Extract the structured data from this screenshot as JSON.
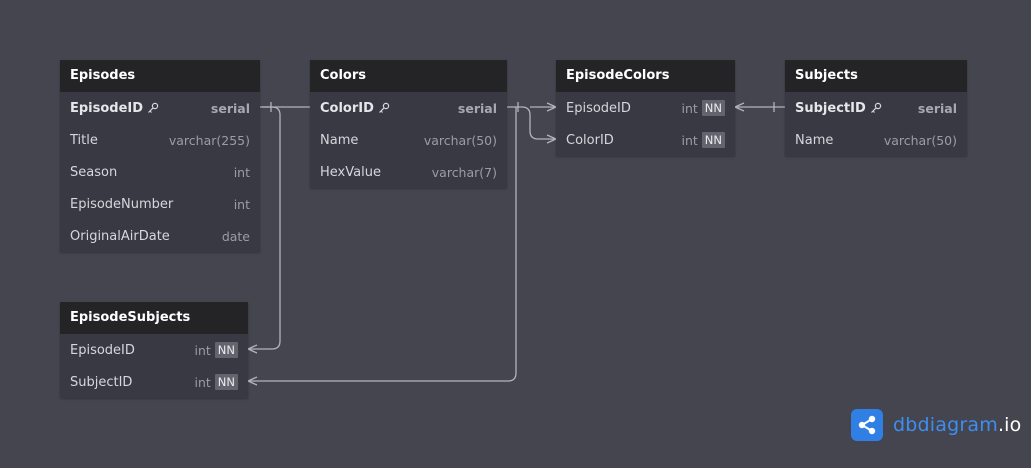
{
  "tables": {
    "episodes": {
      "name": "Episodes",
      "rows": [
        {
          "name": "EpisodeID",
          "type": "serial",
          "pk": true
        },
        {
          "name": "Title",
          "type": "varchar(255)"
        },
        {
          "name": "Season",
          "type": "int"
        },
        {
          "name": "EpisodeNumber",
          "type": "int"
        },
        {
          "name": "OriginalAirDate",
          "type": "date"
        }
      ]
    },
    "colors": {
      "name": "Colors",
      "rows": [
        {
          "name": "ColorID",
          "type": "serial",
          "pk": true
        },
        {
          "name": "Name",
          "type": "varchar(50)"
        },
        {
          "name": "HexValue",
          "type": "varchar(7)"
        }
      ]
    },
    "episode_colors": {
      "name": "EpisodeColors",
      "rows": [
        {
          "name": "EpisodeID",
          "type": "int",
          "nn": "NN"
        },
        {
          "name": "ColorID",
          "type": "int",
          "nn": "NN"
        }
      ]
    },
    "subjects": {
      "name": "Subjects",
      "rows": [
        {
          "name": "SubjectID",
          "type": "serial",
          "pk": true
        },
        {
          "name": "Name",
          "type": "varchar(50)"
        }
      ]
    },
    "episode_subjects": {
      "name": "EpisodeSubjects",
      "rows": [
        {
          "name": "EpisodeID",
          "type": "int",
          "nn": "NN"
        },
        {
          "name": "SubjectID",
          "type": "int",
          "nn": "NN"
        }
      ]
    }
  },
  "brand": {
    "name": "dbdiagram",
    "suffix": ".io",
    "icon": "share-icon"
  },
  "colors": {
    "background": "#45454f",
    "header": "#242426",
    "body": "#393943",
    "brand": "#2f7fe4"
  }
}
